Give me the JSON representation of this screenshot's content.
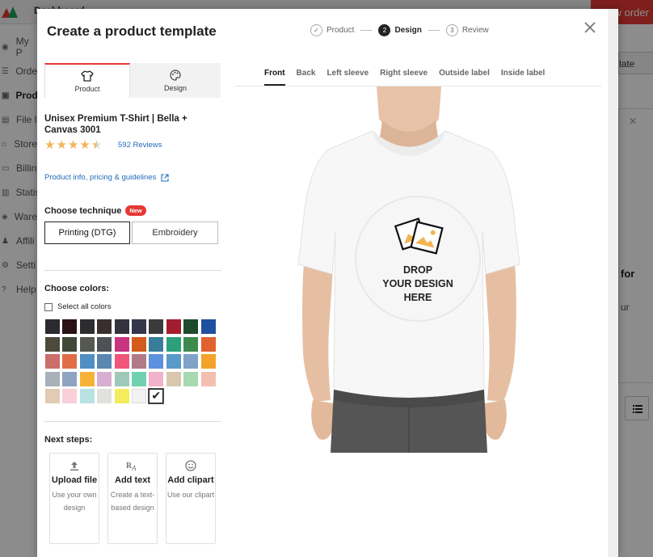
{
  "background": {
    "brand": "Dashboard",
    "order_button": "New order",
    "sidebar_items": [
      "My P",
      "Orde",
      "Produ",
      "File l",
      "Store",
      "Billin",
      "Statis",
      "Ware",
      "Affili",
      "Setti",
      "Help"
    ],
    "right_button": "late",
    "right_for": "for",
    "right_ur": "ur"
  },
  "modal": {
    "title": "Create a product template",
    "steps": [
      {
        "num": "✓",
        "label": "Product"
      },
      {
        "num": "2",
        "label": "Design"
      },
      {
        "num": "3",
        "label": "Review"
      }
    ]
  },
  "left": {
    "tabs": [
      {
        "label": "Product",
        "icon": "shirt-icon"
      },
      {
        "label": "Design",
        "icon": "palette-icon"
      }
    ],
    "product_name": "Unisex Premium T-Shirt | Bella + Canvas 3001",
    "rating": 4.5,
    "reviews": "592 Reviews",
    "info_link": "Product info, pricing & guidelines",
    "technique_label": "Choose technique",
    "new_badge": "New",
    "techniques": [
      "Printing (DTG)",
      "Embroidery"
    ],
    "colors_label": "Choose colors:",
    "select_all": "Select all colors",
    "colors": [
      "#2b2b2f",
      "#2a1115",
      "#2d2d30",
      "#3a2f2f",
      "#33333d",
      "#34374a",
      "#3b3b3b",
      "#a31d2e",
      "#1e4a2d",
      "#1f4f9e",
      "#4c4a3b",
      "#40483a",
      "#55594f",
      "#4e5257",
      "#c8347f",
      "#d35b1b",
      "#3a7d9b",
      "#2ba07a",
      "#3e8a4e",
      "#e0632f",
      "#cc6e6a",
      "#e06d48",
      "#4f8fc4",
      "#5a87b0",
      "#f0557a",
      "#b07a8a",
      "#5e90e0",
      "#5a9ac8",
      "#7fa2c6",
      "#f3a32a",
      "#a8b0b8",
      "#8fa4c2",
      "#f6b238",
      "#d7aed0",
      "#9ec8b8",
      "#70d1b0",
      "#f3b2cb",
      "#d8c7ad",
      "#a8d8b0",
      "#f2c0b0",
      "#e2cbb2",
      "#f9cfd9",
      "#b8e2e2",
      "#e0e0dc",
      "#f4ec5c",
      "#f2f2f2",
      "#ffffff"
    ],
    "next_label": "Next steps:",
    "next_steps": [
      {
        "title": "Upload file",
        "sub": "Use your own design",
        "icon": "upload-icon"
      },
      {
        "title": "Add text",
        "sub": "Create a text-based design",
        "icon": "text-icon"
      },
      {
        "title": "Add clipart",
        "sub": "Use our clipart",
        "icon": "smile-icon"
      }
    ]
  },
  "views": [
    "Front",
    "Back",
    "Left sleeve",
    "Right sleeve",
    "Outside label",
    "Inside label"
  ],
  "drop_text": "DROP\nYOUR DESIGN\nHERE"
}
